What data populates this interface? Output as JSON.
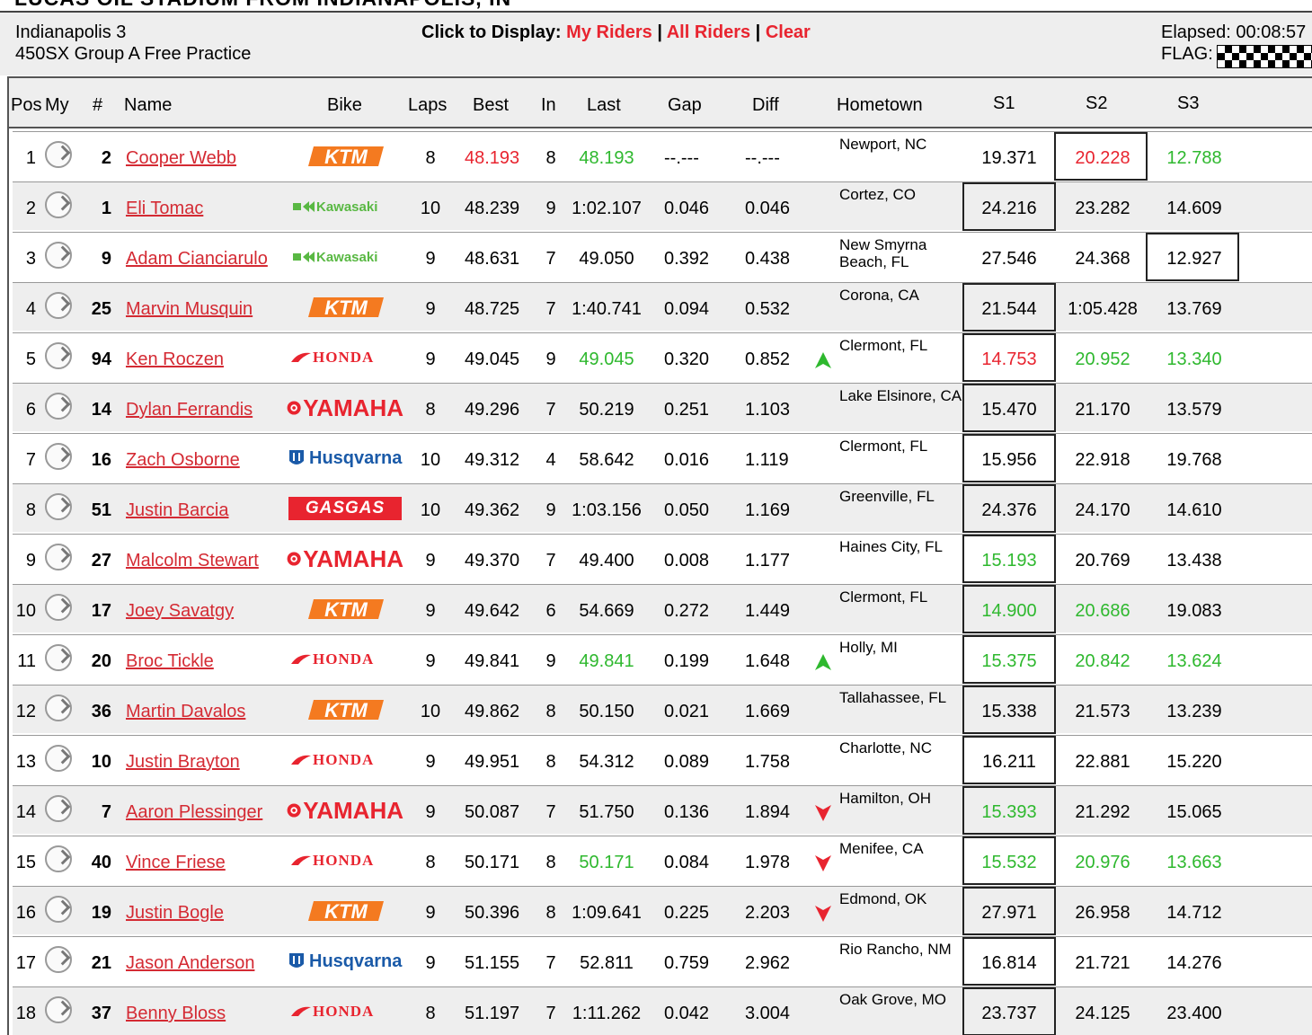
{
  "page": {
    "top_title": "LUCAS OIL STADIUM FROM INDIANAPOLIS, IN",
    "event": "Indianapolis 3",
    "session": "450SX Group A Free Practice",
    "display_label": "Click to Display:",
    "my_riders": "My Riders",
    "all_riders": "All Riders",
    "clear": "Clear",
    "sep1": " | ",
    "sep2": " | ",
    "elapsed_label": "Elapsed:",
    "elapsed_value": "00:08:57",
    "flag_label": "FLAG:",
    "flag_icon": "checkered-flag"
  },
  "columns": {
    "pos": "Pos",
    "my": "My",
    "num": "#",
    "name": "Name",
    "bike": "Bike",
    "laps": "Laps",
    "best": "Best",
    "in": "In",
    "last": "Last",
    "gap": "Gap",
    "diff": "Diff",
    "hometown": "Hometown",
    "s1": "S1",
    "s2": "S2",
    "s3": "S3"
  },
  "colors": {
    "red": "#e8242f",
    "green": "#2eb82e",
    "shade": "#eeeeee"
  },
  "rows": [
    {
      "pos": "1",
      "num": "2",
      "name": "Cooper Webb",
      "bike": "KTM",
      "laps": "8",
      "best": "48.193",
      "in": "8",
      "last": "48.193",
      "gap": "--.---",
      "diff": "--.---",
      "trend": "",
      "town": "Newport, NC",
      "s1": "19.371",
      "s2": "20.228",
      "s3": "12.788",
      "best_c": "red",
      "last_c": "green",
      "s1_c": "",
      "s2_c": "red",
      "s3_c": "green",
      "box": "s2"
    },
    {
      "pos": "2",
      "num": "1",
      "name": "Eli Tomac",
      "bike": "Kawasaki",
      "laps": "10",
      "best": "48.239",
      "in": "9",
      "last": "1:02.107",
      "gap": "0.046",
      "diff": "0.046",
      "trend": "",
      "town": "Cortez, CO",
      "s1": "24.216",
      "s2": "23.282",
      "s3": "14.609",
      "best_c": "",
      "last_c": "",
      "s1_c": "",
      "s2_c": "",
      "s3_c": "",
      "box": "s1"
    },
    {
      "pos": "3",
      "num": "9",
      "name": "Adam Cianciarulo",
      "bike": "Kawasaki",
      "laps": "9",
      "best": "48.631",
      "in": "7",
      "last": "49.050",
      "gap": "0.392",
      "diff": "0.438",
      "trend": "",
      "town": "New Smyrna Beach, FL",
      "s1": "27.546",
      "s2": "24.368",
      "s3": "12.927",
      "best_c": "",
      "last_c": "",
      "s1_c": "",
      "s2_c": "",
      "s3_c": "",
      "box": "s3"
    },
    {
      "pos": "4",
      "num": "25",
      "name": "Marvin Musquin",
      "bike": "KTM",
      "laps": "9",
      "best": "48.725",
      "in": "7",
      "last": "1:40.741",
      "gap": "0.094",
      "diff": "0.532",
      "trend": "",
      "town": "Corona, CA",
      "s1": "21.544",
      "s2": "1:05.428",
      "s3": "13.769",
      "best_c": "",
      "last_c": "",
      "s1_c": "",
      "s2_c": "",
      "s3_c": "",
      "box": "s1"
    },
    {
      "pos": "5",
      "num": "94",
      "name": "Ken Roczen",
      "bike": "HONDA",
      "laps": "9",
      "best": "49.045",
      "in": "9",
      "last": "49.045",
      "gap": "0.320",
      "diff": "0.852",
      "trend": "up",
      "town": "Clermont, FL",
      "s1": "14.753",
      "s2": "20.952",
      "s3": "13.340",
      "best_c": "",
      "last_c": "green",
      "s1_c": "red",
      "s2_c": "green",
      "s3_c": "green",
      "box": "s1"
    },
    {
      "pos": "6",
      "num": "14",
      "name": "Dylan Ferrandis",
      "bike": "YAMAHA",
      "laps": "8",
      "best": "49.296",
      "in": "7",
      "last": "50.219",
      "gap": "0.251",
      "diff": "1.103",
      "trend": "",
      "town": "Lake Elsinore, CA",
      "s1": "15.470",
      "s2": "21.170",
      "s3": "13.579",
      "best_c": "",
      "last_c": "",
      "s1_c": "",
      "s2_c": "",
      "s3_c": "",
      "box": "s1"
    },
    {
      "pos": "7",
      "num": "16",
      "name": "Zach Osborne",
      "bike": "Husqvarna",
      "laps": "10",
      "best": "49.312",
      "in": "4",
      "last": "58.642",
      "gap": "0.016",
      "diff": "1.119",
      "trend": "",
      "town": "Clermont, FL",
      "s1": "15.956",
      "s2": "22.918",
      "s3": "19.768",
      "best_c": "",
      "last_c": "",
      "s1_c": "",
      "s2_c": "",
      "s3_c": "",
      "box": "s1"
    },
    {
      "pos": "8",
      "num": "51",
      "name": "Justin Barcia",
      "bike": "GASGAS",
      "laps": "10",
      "best": "49.362",
      "in": "9",
      "last": "1:03.156",
      "gap": "0.050",
      "diff": "1.169",
      "trend": "",
      "town": "Greenville, FL",
      "s1": "24.376",
      "s2": "24.170",
      "s3": "14.610",
      "best_c": "",
      "last_c": "",
      "s1_c": "",
      "s2_c": "",
      "s3_c": "",
      "box": "s1"
    },
    {
      "pos": "9",
      "num": "27",
      "name": "Malcolm Stewart",
      "bike": "YAMAHA",
      "laps": "9",
      "best": "49.370",
      "in": "7",
      "last": "49.400",
      "gap": "0.008",
      "diff": "1.177",
      "trend": "",
      "town": "Haines City, FL",
      "s1": "15.193",
      "s2": "20.769",
      "s3": "13.438",
      "best_c": "",
      "last_c": "",
      "s1_c": "green",
      "s2_c": "",
      "s3_c": "",
      "box": "s1"
    },
    {
      "pos": "10",
      "num": "17",
      "name": "Joey Savatgy",
      "bike": "KTM",
      "laps": "9",
      "best": "49.642",
      "in": "6",
      "last": "54.669",
      "gap": "0.272",
      "diff": "1.449",
      "trend": "",
      "town": "Clermont, FL",
      "s1": "14.900",
      "s2": "20.686",
      "s3": "19.083",
      "best_c": "",
      "last_c": "",
      "s1_c": "green",
      "s2_c": "green",
      "s3_c": "",
      "box": "s1"
    },
    {
      "pos": "11",
      "num": "20",
      "name": "Broc Tickle",
      "bike": "HONDA",
      "laps": "9",
      "best": "49.841",
      "in": "9",
      "last": "49.841",
      "gap": "0.199",
      "diff": "1.648",
      "trend": "up",
      "town": "Holly, MI",
      "s1": "15.375",
      "s2": "20.842",
      "s3": "13.624",
      "best_c": "",
      "last_c": "green",
      "s1_c": "green",
      "s2_c": "green",
      "s3_c": "green",
      "box": "s1"
    },
    {
      "pos": "12",
      "num": "36",
      "name": "Martin Davalos",
      "bike": "KTM",
      "laps": "10",
      "best": "49.862",
      "in": "8",
      "last": "50.150",
      "gap": "0.021",
      "diff": "1.669",
      "trend": "",
      "town": "Tallahassee, FL",
      "s1": "15.338",
      "s2": "21.573",
      "s3": "13.239",
      "best_c": "",
      "last_c": "",
      "s1_c": "",
      "s2_c": "",
      "s3_c": "",
      "box": "s1"
    },
    {
      "pos": "13",
      "num": "10",
      "name": "Justin Brayton",
      "bike": "HONDA",
      "laps": "9",
      "best": "49.951",
      "in": "8",
      "last": "54.312",
      "gap": "0.089",
      "diff": "1.758",
      "trend": "",
      "town": "Charlotte, NC",
      "s1": "16.211",
      "s2": "22.881",
      "s3": "15.220",
      "best_c": "",
      "last_c": "",
      "s1_c": "",
      "s2_c": "",
      "s3_c": "",
      "box": "s1"
    },
    {
      "pos": "14",
      "num": "7",
      "name": "Aaron Plessinger",
      "bike": "YAMAHA",
      "laps": "9",
      "best": "50.087",
      "in": "7",
      "last": "51.750",
      "gap": "0.136",
      "diff": "1.894",
      "trend": "down",
      "town": "Hamilton, OH",
      "s1": "15.393",
      "s2": "21.292",
      "s3": "15.065",
      "best_c": "",
      "last_c": "",
      "s1_c": "green",
      "s2_c": "",
      "s3_c": "",
      "box": "s1"
    },
    {
      "pos": "15",
      "num": "40",
      "name": "Vince Friese",
      "bike": "HONDA",
      "laps": "8",
      "best": "50.171",
      "in": "8",
      "last": "50.171",
      "gap": "0.084",
      "diff": "1.978",
      "trend": "down",
      "town": "Menifee, CA",
      "s1": "15.532",
      "s2": "20.976",
      "s3": "13.663",
      "best_c": "",
      "last_c": "green",
      "s1_c": "green",
      "s2_c": "green",
      "s3_c": "green",
      "box": "s1"
    },
    {
      "pos": "16",
      "num": "19",
      "name": "Justin Bogle",
      "bike": "KTM",
      "laps": "9",
      "best": "50.396",
      "in": "8",
      "last": "1:09.641",
      "gap": "0.225",
      "diff": "2.203",
      "trend": "down",
      "town": "Edmond, OK",
      "s1": "27.971",
      "s2": "26.958",
      "s3": "14.712",
      "best_c": "",
      "last_c": "",
      "s1_c": "",
      "s2_c": "",
      "s3_c": "",
      "box": "s1"
    },
    {
      "pos": "17",
      "num": "21",
      "name": "Jason Anderson",
      "bike": "Husqvarna",
      "laps": "9",
      "best": "51.155",
      "in": "7",
      "last": "52.811",
      "gap": "0.759",
      "diff": "2.962",
      "trend": "",
      "town": "Rio Rancho, NM",
      "s1": "16.814",
      "s2": "21.721",
      "s3": "14.276",
      "best_c": "",
      "last_c": "",
      "s1_c": "",
      "s2_c": "",
      "s3_c": "",
      "box": "s1"
    },
    {
      "pos": "18",
      "num": "37",
      "name": "Benny Bloss",
      "bike": "HONDA",
      "laps": "8",
      "best": "51.197",
      "in": "7",
      "last": "1:11.262",
      "gap": "0.042",
      "diff": "3.004",
      "trend": "",
      "town": "Oak Grove, MO",
      "s1": "23.737",
      "s2": "24.125",
      "s3": "23.400",
      "best_c": "",
      "last_c": "",
      "s1_c": "",
      "s2_c": "",
      "s3_c": "",
      "box": "s1"
    }
  ]
}
